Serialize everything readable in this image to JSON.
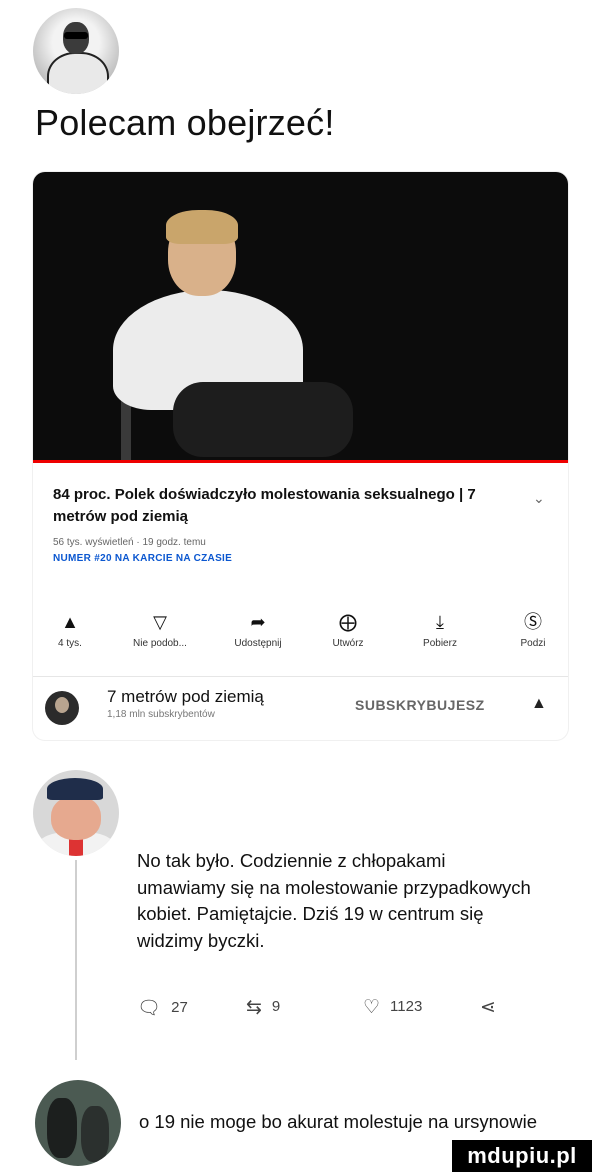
{
  "post1": {
    "text": "Polecam obejrzeć!"
  },
  "video": {
    "title": "84 proc. Polek doświadczyło molestowania seksualnego | 7 metrów pod ziemią",
    "meta": "56 tys. wyświetleń · 19 godz. temu",
    "hashtag": "NUMER #20 NA KARCIE NA CZASIE",
    "actions": [
      {
        "icon": "like-icon",
        "label": "4 tys."
      },
      {
        "icon": "dislike-icon",
        "label": "Nie podob..."
      },
      {
        "icon": "share-icon",
        "label": "Udostępnij"
      },
      {
        "icon": "remix-icon",
        "label": "Utwórz"
      },
      {
        "icon": "download-icon",
        "label": "Pobierz"
      },
      {
        "icon": "thanks-icon",
        "label": "Podzi"
      }
    ],
    "channel": {
      "name": "7 metrów pod ziemią",
      "subscribers": "1,18 mln subskrybentów",
      "subscribe_label": "SUBSKRYBUJESZ"
    }
  },
  "post2": {
    "text": "No tak było. Codziennie z chłopakami umawiamy się na molestowanie przypadkowych kobiet. Pamiętajcie. Dziś 19 w centrum się widzimy byczki.",
    "stats": {
      "replies": "27",
      "retweets": "9",
      "likes": "1123"
    }
  },
  "post3": {
    "text": "o 19 nie moge bo akurat molestuje na ursynowie"
  },
  "watermark": "mdupiu.pl",
  "colors": {
    "progress": "#e00000",
    "hashtag": "#0b57d0",
    "watermark_bg": "#000000"
  }
}
